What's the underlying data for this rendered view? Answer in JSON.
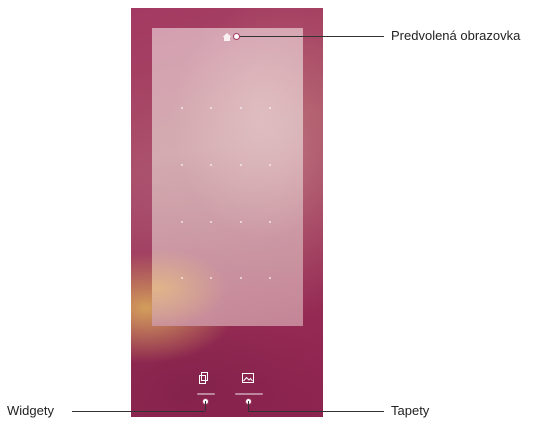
{
  "callouts": {
    "home_screen": "Predvolená obrazovka",
    "widgets": "Widgety",
    "wallpapers": "Tapety"
  },
  "icons": {
    "home": "home-icon",
    "widgets": "widgets-icon",
    "wallpapers": "wallpaper-icon"
  },
  "colors": {
    "accent": "#a33a63"
  }
}
